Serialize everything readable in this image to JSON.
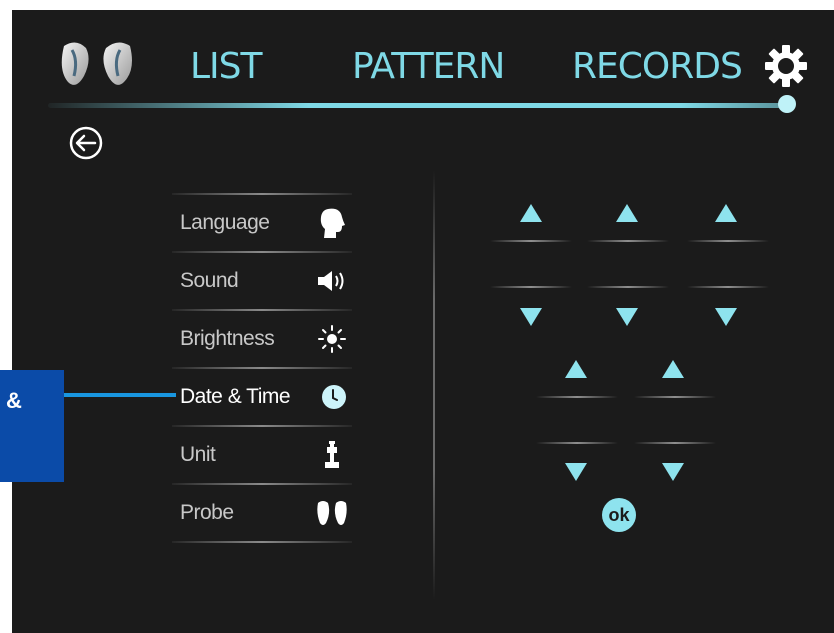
{
  "nav": {
    "list_label": "LIST",
    "pattern_label": "PATTERN",
    "records_label": "RECORDS"
  },
  "icons": {
    "logo": "dual-probe-logo-icon",
    "settings": "gear-icon",
    "back": "back-arrow-icon"
  },
  "menu": {
    "items": [
      {
        "label": "Language",
        "icon": "head-icon"
      },
      {
        "label": "Sound",
        "icon": "speaker-icon"
      },
      {
        "label": "Brightness",
        "icon": "sun-icon"
      },
      {
        "label": "Date & Time",
        "icon": "clock-icon"
      },
      {
        "label": "Unit",
        "icon": "unit-icon"
      },
      {
        "label": "Probe",
        "icon": "probe-icon"
      }
    ]
  },
  "ok_label": "ok",
  "callout_text": "&",
  "colors": {
    "accent": "#7fd9e6",
    "background": "#1b1b1b",
    "callout": "#0b4ba8"
  }
}
